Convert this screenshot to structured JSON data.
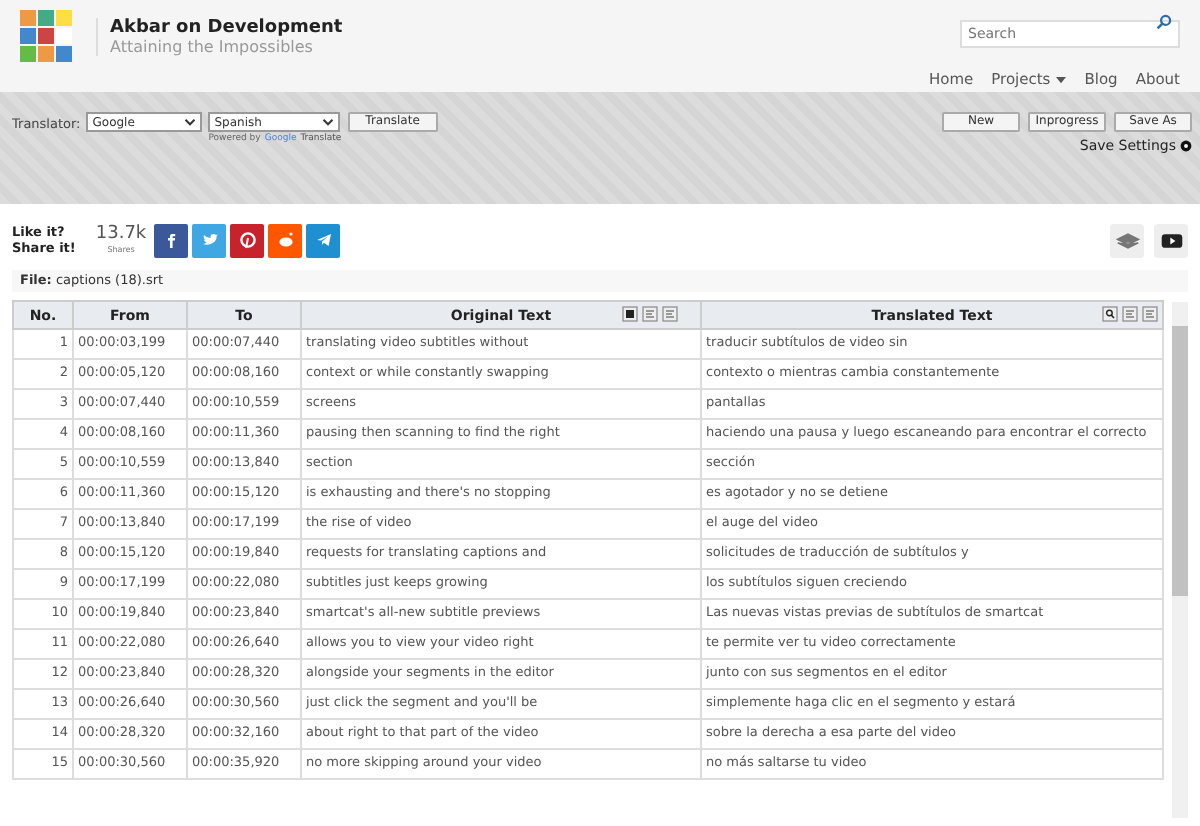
{
  "site": {
    "title": "Akbar on Development",
    "tagline": "Attaining the Impossibles"
  },
  "search": {
    "placeholder": "Search"
  },
  "nav": [
    {
      "label": "Home",
      "dropdown": false
    },
    {
      "label": "Projects",
      "dropdown": true
    },
    {
      "label": "Blog",
      "dropdown": false
    },
    {
      "label": "About",
      "dropdown": false
    }
  ],
  "toolbar": {
    "translator_label": "Translator:",
    "engine": "Google",
    "language": "Spanish",
    "translate_button": "Translate",
    "powered_by": "Powered by",
    "powered_brand": "Google",
    "powered_product": "Translate",
    "buttons": [
      "New",
      "Inprogress",
      "Save As"
    ],
    "settings": "Save Settings"
  },
  "share": {
    "prompt": [
      "Like it?",
      "Share it!"
    ],
    "count": "13.7k",
    "count_label": "Shares",
    "networks": [
      {
        "kind": "facebook",
        "color": "#3b5998"
      },
      {
        "kind": "twitter",
        "color": "#3fa7e1"
      },
      {
        "kind": "pinterest",
        "color": "#c8232c"
      },
      {
        "kind": "reddit",
        "color": "#ff5700"
      },
      {
        "kind": "telegram",
        "color": "#1e8fd0"
      }
    ]
  },
  "file": {
    "label": "File:",
    "name": "captions (18).srt"
  },
  "table": {
    "columns": [
      "No.",
      "From",
      "To",
      "Original Text",
      "Translated Text"
    ],
    "rows": [
      [
        "1",
        "00:00:03,199",
        "00:00:07,440",
        "translating video subtitles without",
        "traducir subtítulos de video sin"
      ],
      [
        "2",
        "00:00:05,120",
        "00:00:08,160",
        "context or while constantly swapping",
        "contexto o mientras cambia constantemente"
      ],
      [
        "3",
        "00:00:07,440",
        "00:00:10,559",
        "screens",
        "pantallas"
      ],
      [
        "4",
        "00:00:08,160",
        "00:00:11,360",
        "pausing then scanning to find the right",
        "haciendo una pausa y luego escaneando para encontrar el correcto"
      ],
      [
        "5",
        "00:00:10,559",
        "00:00:13,840",
        "section",
        "sección"
      ],
      [
        "6",
        "00:00:11,360",
        "00:00:15,120",
        "is exhausting and there's no stopping",
        "es agotador y no se detiene"
      ],
      [
        "7",
        "00:00:13,840",
        "00:00:17,199",
        "the rise of video",
        "el auge del video"
      ],
      [
        "8",
        "00:00:15,120",
        "00:00:19,840",
        "requests for translating captions and",
        "solicitudes de traducción de subtítulos y"
      ],
      [
        "9",
        "00:00:17,199",
        "00:00:22,080",
        "subtitles just keeps growing",
        "los subtítulos siguen creciendo"
      ],
      [
        "10",
        "00:00:19,840",
        "00:00:23,840",
        "smartcat's all-new subtitle previews",
        "Las nuevas vistas previas de subtítulos de smartcat"
      ],
      [
        "11",
        "00:00:22,080",
        "00:00:26,640",
        "allows you to view your video right",
        "te permite ver tu video correctamente"
      ],
      [
        "12",
        "00:00:23,840",
        "00:00:28,320",
        "alongside your segments in the editor",
        "junto con sus segmentos en el editor"
      ],
      [
        "13",
        "00:00:26,640",
        "00:00:30,560",
        "just click the segment and you'll be",
        "simplemente haga clic en el segmento y estará"
      ],
      [
        "14",
        "00:00:28,320",
        "00:00:32,160",
        "about right to that part of the video",
        "sobre la derecha a esa parte del video"
      ],
      [
        "15",
        "00:00:30,560",
        "00:00:35,920",
        "no more skipping around your video",
        "no más saltarse tu video"
      ]
    ]
  }
}
